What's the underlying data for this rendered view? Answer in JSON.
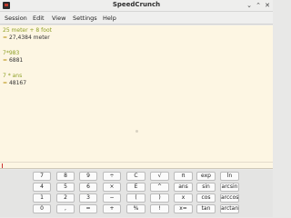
{
  "window": {
    "title": "SpeedCrunch"
  },
  "menu": [
    "Session",
    "Edit",
    "View",
    "Settings",
    "Help"
  ],
  "results": [
    {
      "expr": "25 meter + 8 foot",
      "result": "27,4384 meter"
    },
    {
      "expr": "7*983",
      "result": "6881"
    },
    {
      "expr": "7 * ans",
      "result": "48167"
    }
  ],
  "result_marker": "=",
  "editor": {
    "value": ""
  },
  "keypad": {
    "rows": [
      [
        "7",
        "8",
        "9",
        "÷",
        "C",
        "√",
        "π",
        "exp",
        "ln"
      ],
      [
        "4",
        "5",
        "6",
        "×",
        "E",
        "^",
        "ans",
        "sin",
        "arcsin"
      ],
      [
        "1",
        "2",
        "3",
        "−",
        "(",
        ")",
        "x",
        "cos",
        "arccos"
      ],
      [
        "0",
        ",",
        "=",
        "+",
        "%",
        "!",
        "x=",
        "tan",
        "arctan"
      ]
    ]
  }
}
